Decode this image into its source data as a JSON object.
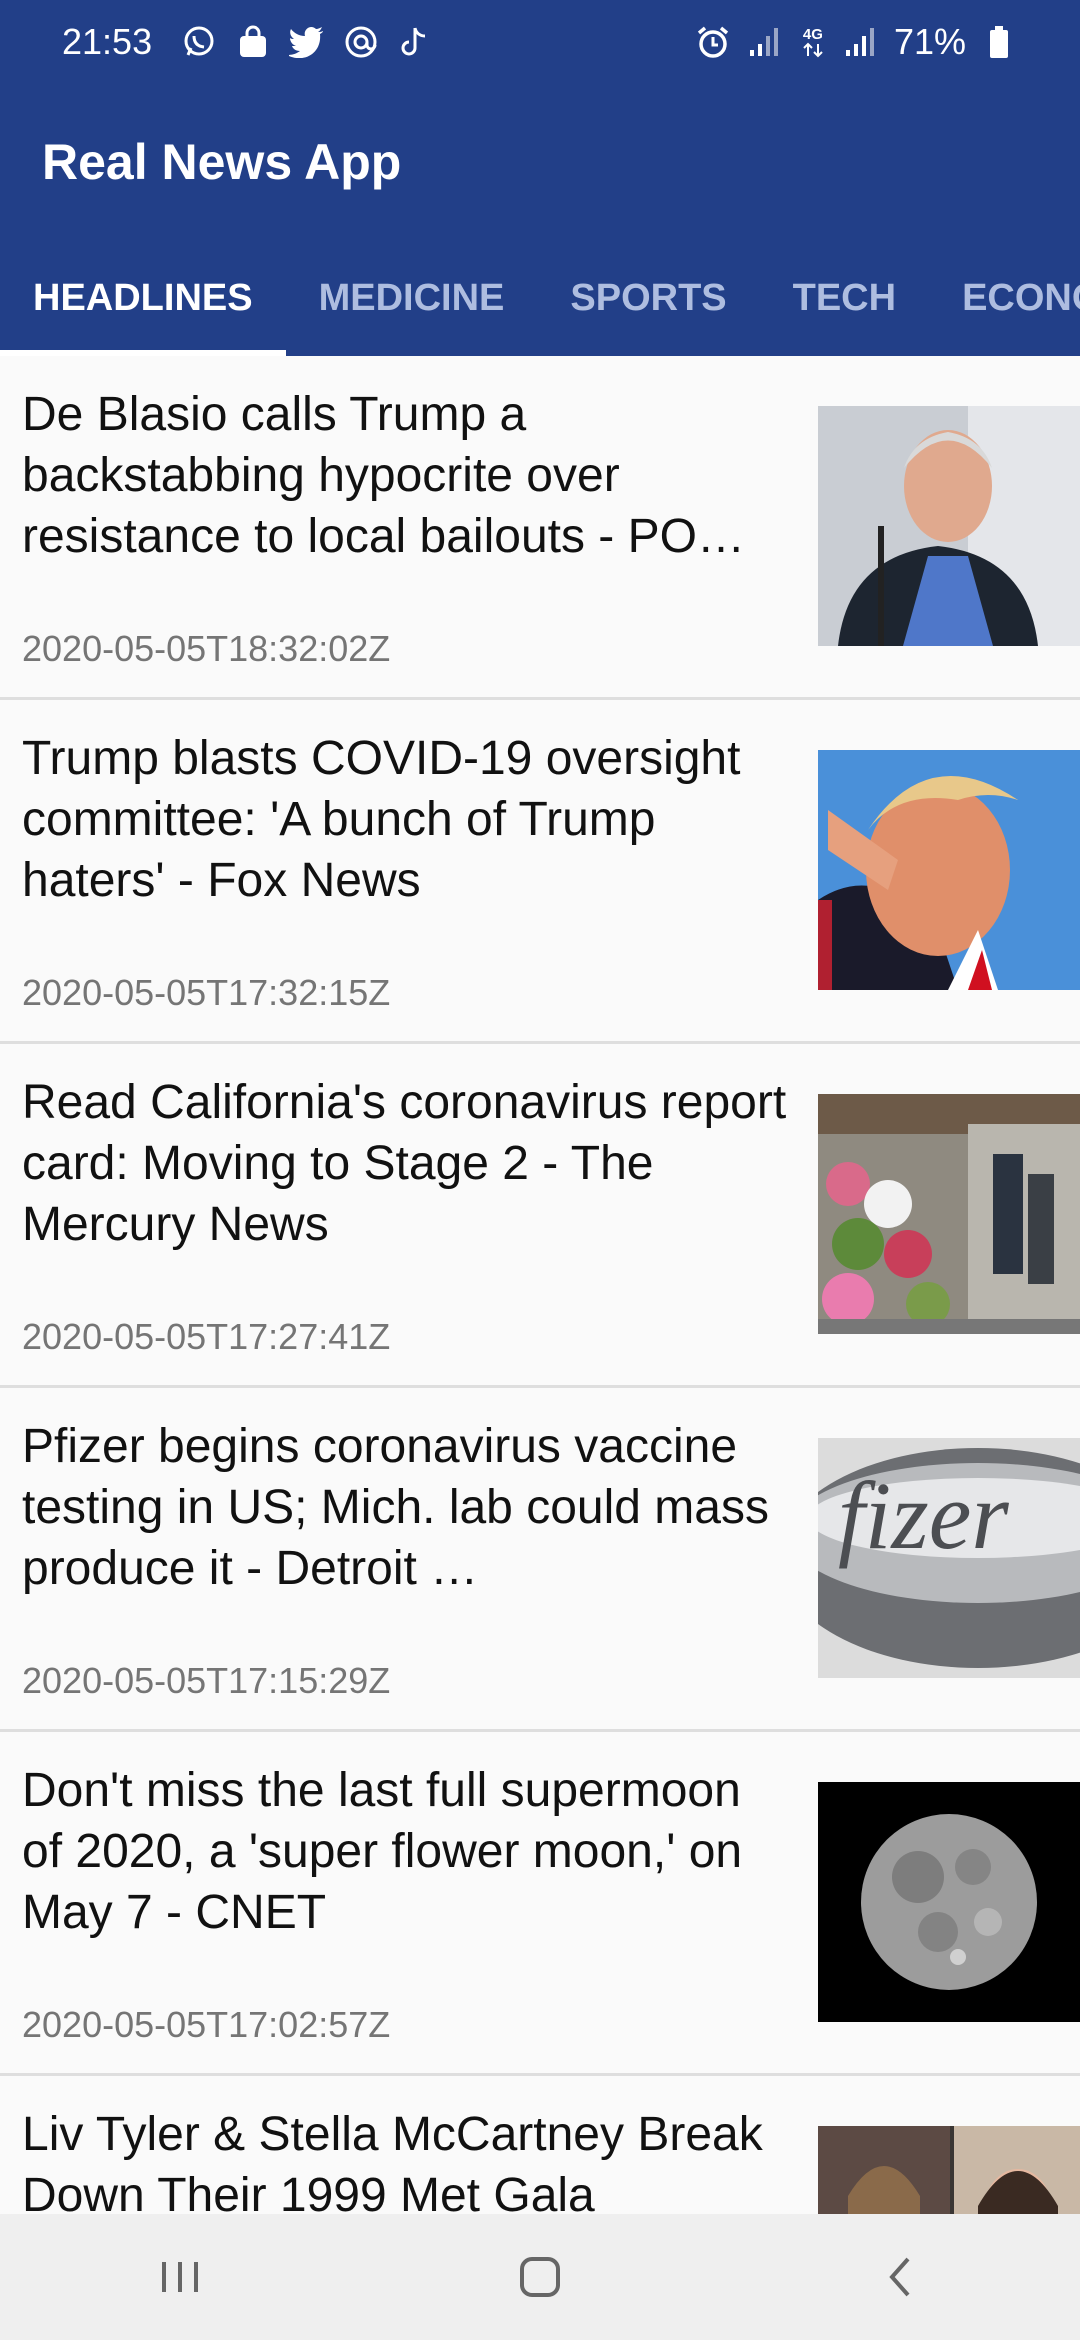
{
  "status_bar": {
    "time": "21:53",
    "left_icons": [
      "whatsapp-icon",
      "shopping-bag-icon",
      "twitter-icon",
      "at-sign-icon",
      "tiktok-icon"
    ],
    "right_icons": [
      "alarm-icon",
      "signal-icon",
      "4g-icon",
      "signal-icon",
      "battery-icon"
    ],
    "network_label": "4G",
    "battery_percent": "71%"
  },
  "app_bar": {
    "title": "Real News App"
  },
  "tabs": [
    {
      "label": "HEADLINES",
      "active": true
    },
    {
      "label": "MEDICINE",
      "active": false
    },
    {
      "label": "SPORTS",
      "active": false
    },
    {
      "label": "TECH",
      "active": false
    },
    {
      "label": "ECONOM",
      "active": false
    }
  ],
  "articles": [
    {
      "headline": "De Blasio calls Trump a backstabbing hypocrite over resistance to local bailouts - PO…",
      "date": "2020-05-05T18:32:02Z",
      "thumb": "portrait-man-gray-hair"
    },
    {
      "headline": "Trump blasts COVID-19 oversight committee: 'A bunch of Trump haters' - Fox News",
      "date": "2020-05-05T17:32:15Z",
      "thumb": "man-speaking-blue-sky"
    },
    {
      "headline": "Read California's coronavirus report card: Moving to Stage 2 - The Mercury News",
      "date": "2020-05-05T17:27:41Z",
      "thumb": "flower-market-street"
    },
    {
      "headline": "Pfizer begins coronavirus vaccine testing in US; Mich. lab could mass produce it - Detroit …",
      "date": "2020-05-05T17:15:29Z",
      "thumb": "pfizer-logo-sign"
    },
    {
      "headline": "Don't miss the last full supermoon of 2020, a 'super flower moon,' on May 7 - CNET",
      "date": "2020-05-05T17:02:57Z",
      "thumb": "full-moon"
    },
    {
      "headline": "Liv Tyler & Stella McCartney Break Down Their 1999 Met Gala",
      "date": "",
      "thumb": "photo-collage"
    }
  ],
  "colors": {
    "primary": "#223f88",
    "tab_inactive": "#aebde0",
    "date_text": "#757575"
  }
}
